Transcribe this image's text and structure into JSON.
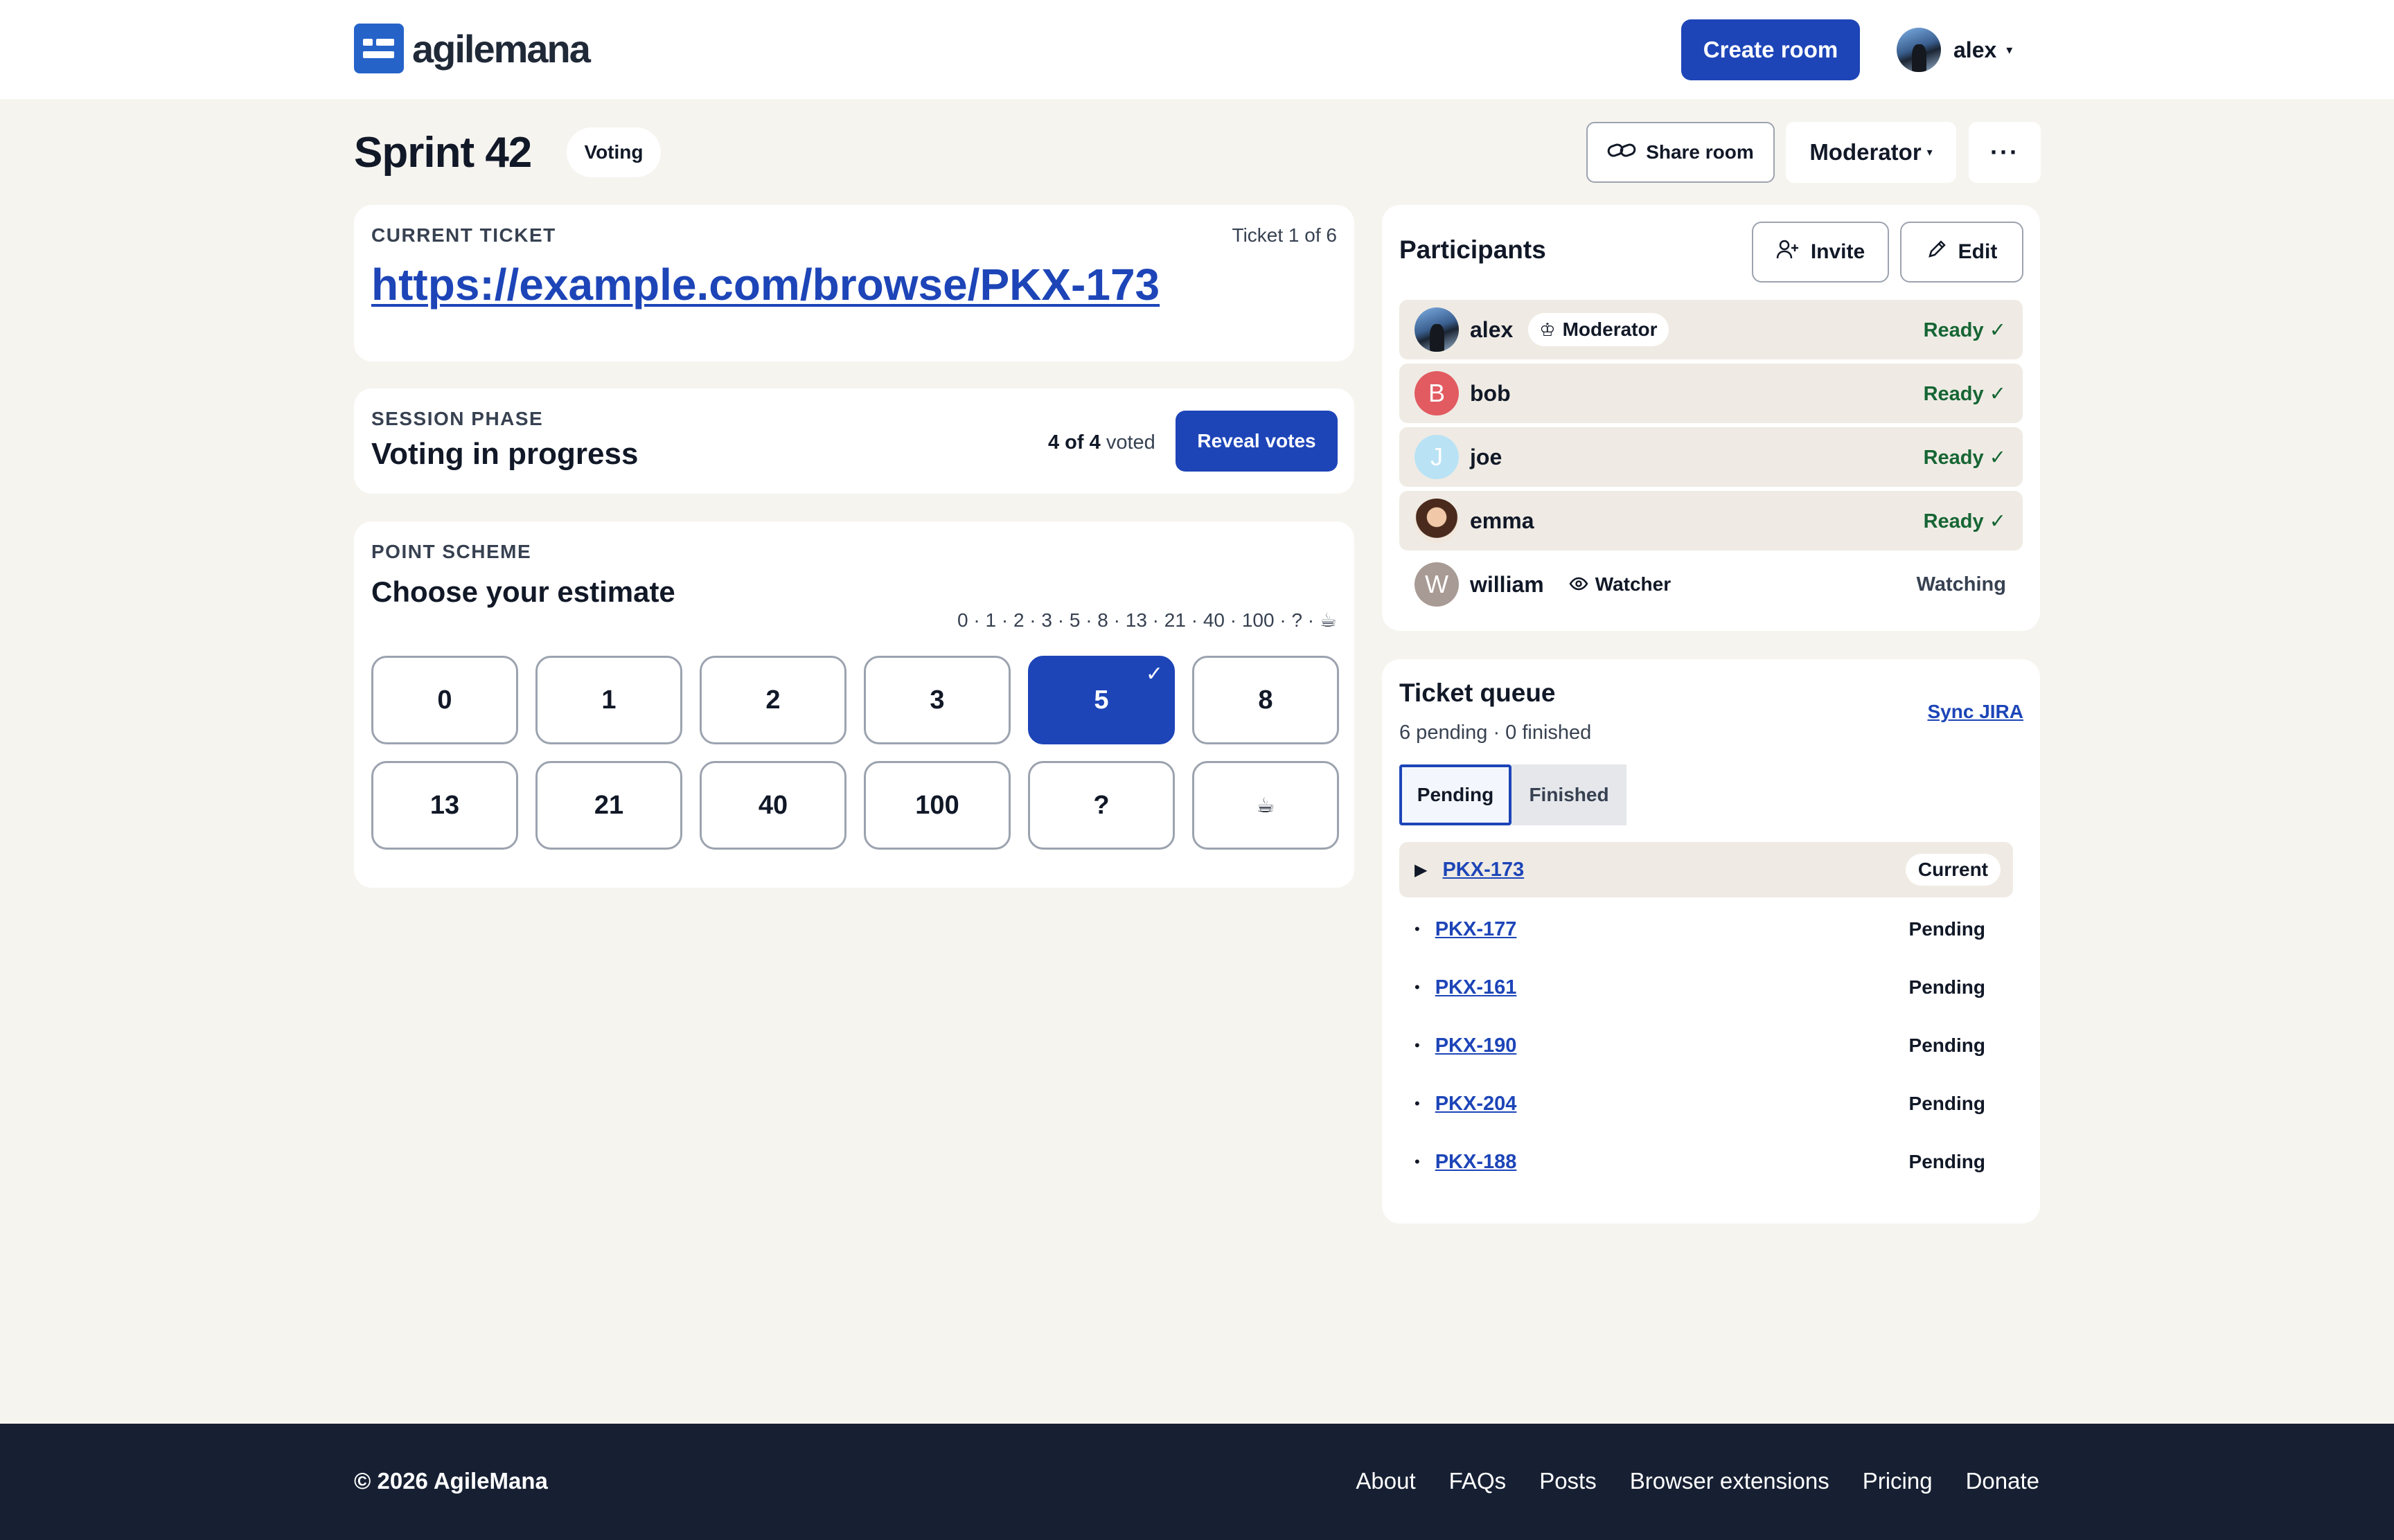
{
  "brand": {
    "name": "agilemana",
    "accent": "#1d45b8"
  },
  "header": {
    "create_room": "Create room",
    "user": "alex",
    "caret": "▾"
  },
  "room": {
    "title": "Sprint 42",
    "phase_badge": "Voting",
    "share": "Share room",
    "role": "Moderator",
    "more": "···"
  },
  "ticket": {
    "label": "CURRENT TICKET",
    "count": "Ticket 1 of 6",
    "url": "https://example.com/browse/PKX-173"
  },
  "session": {
    "label": "SESSION PHASE",
    "phase": "Voting in progress",
    "voted_strong": "4 of 4",
    "voted_suffix": "voted",
    "reveal": "Reveal votes"
  },
  "scheme": {
    "label": "POINT SCHEME",
    "title": "Choose your estimate",
    "values_line": "0 · 1 · 2 · 3 · 5 · 8 · 13 · 21 · 40 · 100 · ? · ☕",
    "cards": [
      "0",
      "1",
      "2",
      "3",
      "5",
      "8",
      "13",
      "21",
      "40",
      "100",
      "?",
      "☕"
    ],
    "selected": "5"
  },
  "participants": {
    "title": "Participants",
    "invite": "Invite",
    "edit": "Edit",
    "list": [
      {
        "name": "alex",
        "role": "Moderator",
        "status": "Ready ✓"
      },
      {
        "name": "bob",
        "initial": "B",
        "status": "Ready ✓",
        "color": "#e15b61"
      },
      {
        "name": "joe",
        "initial": "J",
        "status": "Ready ✓",
        "color": "#a7d8f0"
      },
      {
        "name": "emma",
        "status": "Ready ✓"
      },
      {
        "name": "william",
        "initial": "W",
        "role": "Watcher",
        "status": "Watching",
        "color": "#a89a94"
      }
    ]
  },
  "queue": {
    "title": "Ticket queue",
    "sync": "Sync JIRA",
    "summary": "6 pending · 0 finished",
    "tabs": [
      "Pending",
      "Finished"
    ],
    "items": [
      {
        "id": "PKX-173",
        "status": "Current"
      },
      {
        "id": "PKX-177",
        "status": "Pending"
      },
      {
        "id": "PKX-161",
        "status": "Pending"
      },
      {
        "id": "PKX-190",
        "status": "Pending"
      },
      {
        "id": "PKX-204",
        "status": "Pending"
      },
      {
        "id": "PKX-188",
        "status": "Pending"
      }
    ]
  },
  "footer": {
    "copyright": "© 2026 AgileMana",
    "links": [
      "About",
      "FAQs",
      "Posts",
      "Browser extensions",
      "Pricing",
      "Donate"
    ]
  }
}
